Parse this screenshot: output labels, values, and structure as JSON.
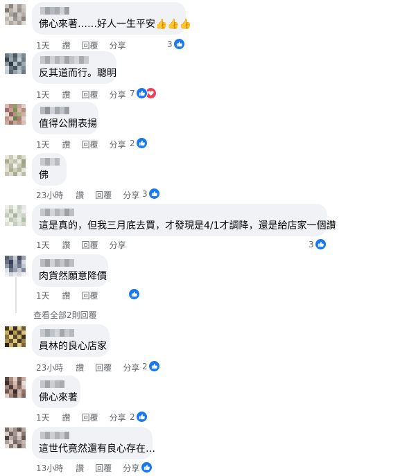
{
  "comments": [
    {
      "text": "佛心來著……好人一生平安👍👍👍",
      "time": "1天",
      "reply_actions": [
        "讚",
        "回覆",
        "分享"
      ],
      "reactions": "3"
    },
    {
      "text": "反其道而行。聰明",
      "time": "1天",
      "reply_actions": [
        "讚",
        "回覆",
        "分享"
      ],
      "reactions": "7"
    },
    {
      "text": "值得公開表揚",
      "time": "1天",
      "reply_actions": [
        "讚",
        "回覆",
        "分享"
      ],
      "reactions": "2"
    },
    {
      "text": "佛",
      "time": "23小時",
      "reply_actions": [
        "讚",
        "回覆",
        "分享"
      ],
      "reactions": "3"
    },
    {
      "text": "這是真的，但我三月底去買，才發現是4/1才調降，還是給店家一個讚",
      "time": "1天",
      "reply_actions": [
        "讚",
        "回覆",
        "分享"
      ],
      "reactions": "3"
    },
    {
      "text": "肉貨然願意降價",
      "time": "1天",
      "reply_actions": [
        "讚",
        "回覆"
      ],
      "reactions": ""
    },
    {
      "text": "員林的良心店家",
      "time": "23小時",
      "reply_actions": [
        "讚",
        "回覆",
        "分享"
      ],
      "reactions": "2"
    },
    {
      "text": "佛心來著",
      "time": "1天",
      "reply_actions": [
        "讚",
        "回覆",
        "分享"
      ],
      "reactions": "2"
    },
    {
      "text": "這世代竟然還有良心存在…",
      "time": "13小時",
      "reply_actions": [
        "讚",
        "回覆",
        "分享"
      ],
      "reactions": ""
    }
  ],
  "view_all_replies": "查看全部2則回覆",
  "colors": {
    "like": "#1877f2",
    "love": "#f33e58",
    "bubble": "#f0f2f5",
    "meta": "#65676b"
  }
}
